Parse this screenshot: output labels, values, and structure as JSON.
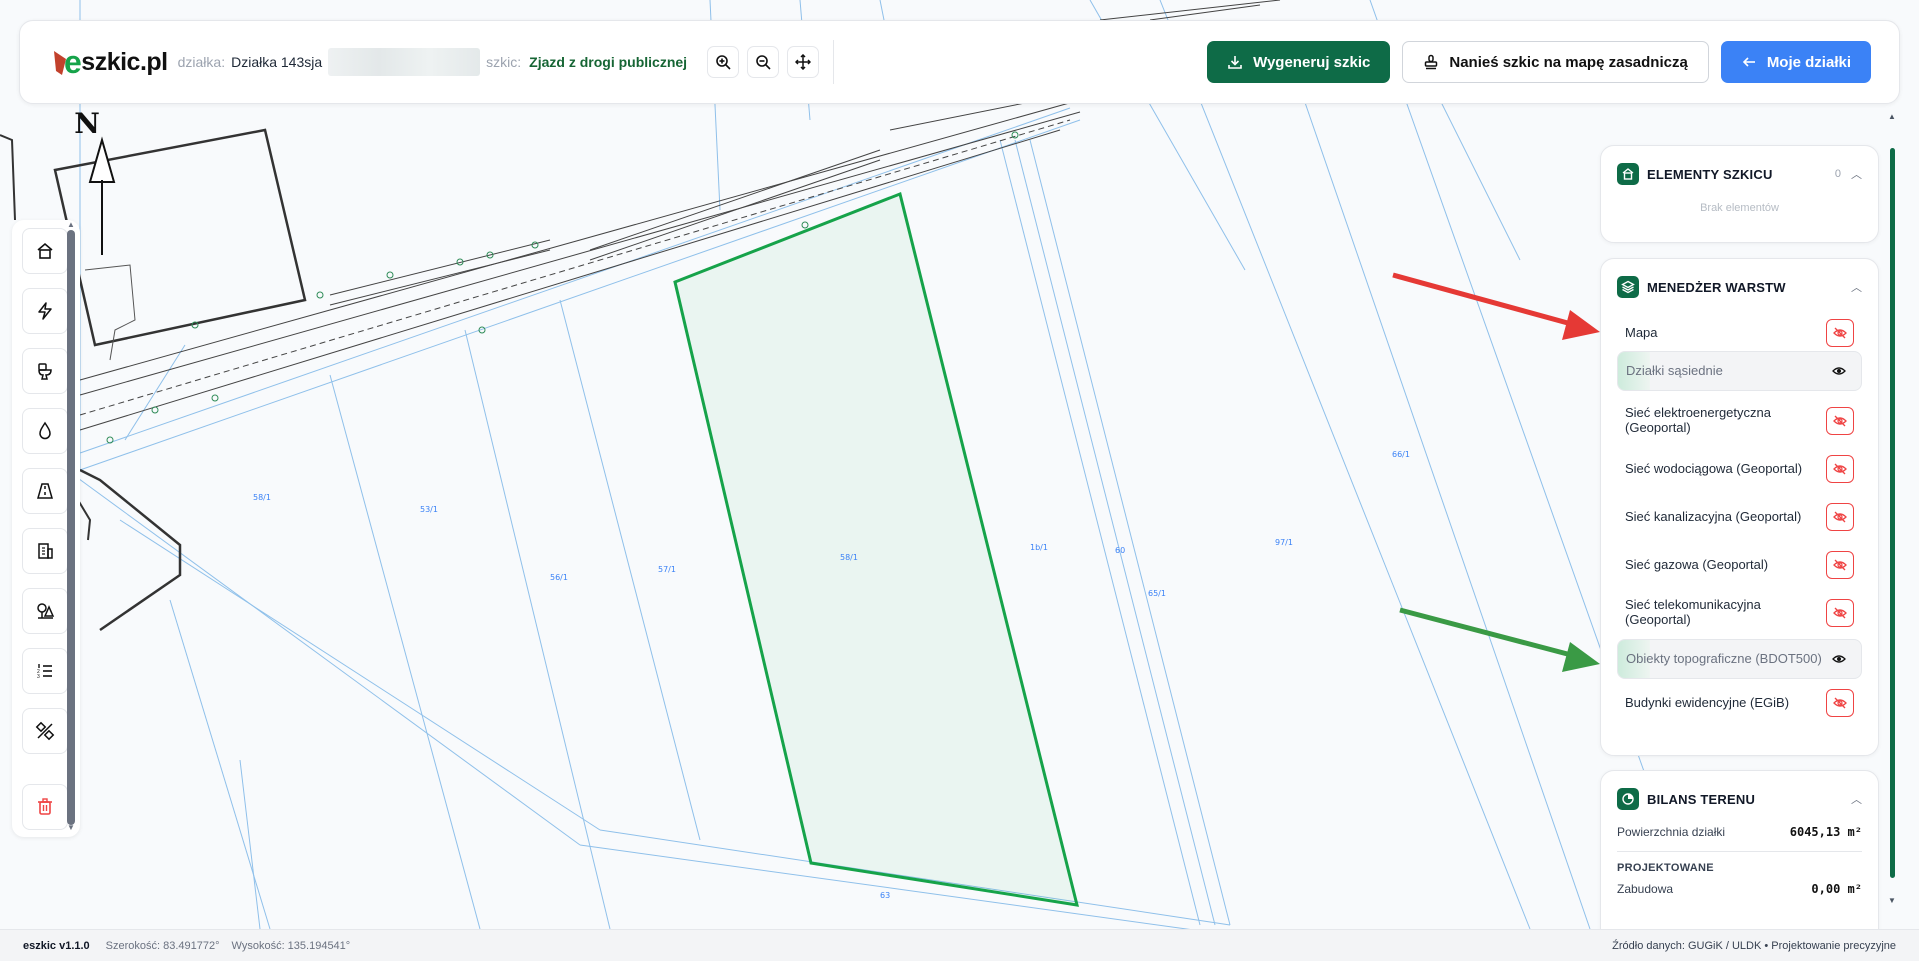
{
  "brand": {
    "name": "eszkic.pl",
    "prefix": "e",
    "rest": "szkic.pl"
  },
  "header": {
    "parcel_label": "działka:",
    "parcel_value": "Działka 143sja",
    "sketch_label": "szkic:",
    "sketch_value": "Zjazd z drogi publicznej",
    "generate_label": "Wygeneruj szkic",
    "stamp_label": "Nanieś szkic na mapę zasadniczą",
    "mine_label": "Moje działki"
  },
  "map": {
    "north": "N",
    "parcel_labels": [
      "58/1",
      "53/1",
      "56/1",
      "57/1",
      "58/1",
      "1b/1",
      "60",
      "65/1",
      "97/1",
      "66/1",
      "63"
    ]
  },
  "panel": {
    "elements": {
      "title": "ELEMENTY SZKICU",
      "count": "0",
      "empty": "Brak elementów"
    },
    "layers": {
      "title": "MENEDŻER WARSTW",
      "items": [
        {
          "name": "Mapa",
          "visible": false
        },
        {
          "name": "Działki sąsiednie",
          "visible": true
        },
        {
          "name": "Sieć elektroenergetyczna (Geoportal)",
          "visible": false
        },
        {
          "name": "Sieć wodociągowa (Geoportal)",
          "visible": false
        },
        {
          "name": "Sieć kanalizacyjna (Geoportal)",
          "visible": false
        },
        {
          "name": "Sieć gazowa (Geoportal)",
          "visible": false
        },
        {
          "name": "Sieć telekomunikacyjna (Geoportal)",
          "visible": false
        },
        {
          "name": "Obiekty topograficzne (BDOT500)",
          "visible": true
        },
        {
          "name": "Budynki ewidencyjne (EGiB)",
          "visible": false
        }
      ]
    },
    "balance": {
      "title": "BILANS TERENU",
      "area_label": "Powierzchnia działki",
      "area_value": "6045,13 m²",
      "section": "PROJEKTOWANE",
      "built_label": "Zabudowa",
      "built_value": "0,00 m²"
    }
  },
  "footer": {
    "version": "eszkic v1.1.0",
    "lat": "Szerokość: 83.491772°",
    "height": "Wysokość: 135.194541°",
    "source": "Źródło danych: GUGiK / ULDK • Projektowanie precyzyjne"
  },
  "colors": {
    "accent": "#0e6b47",
    "blue": "#3b82f6",
    "parcel": "#16a34a",
    "danger": "#ef4444",
    "arrow_red": "#e53935",
    "arrow_green": "#3a9a45"
  }
}
